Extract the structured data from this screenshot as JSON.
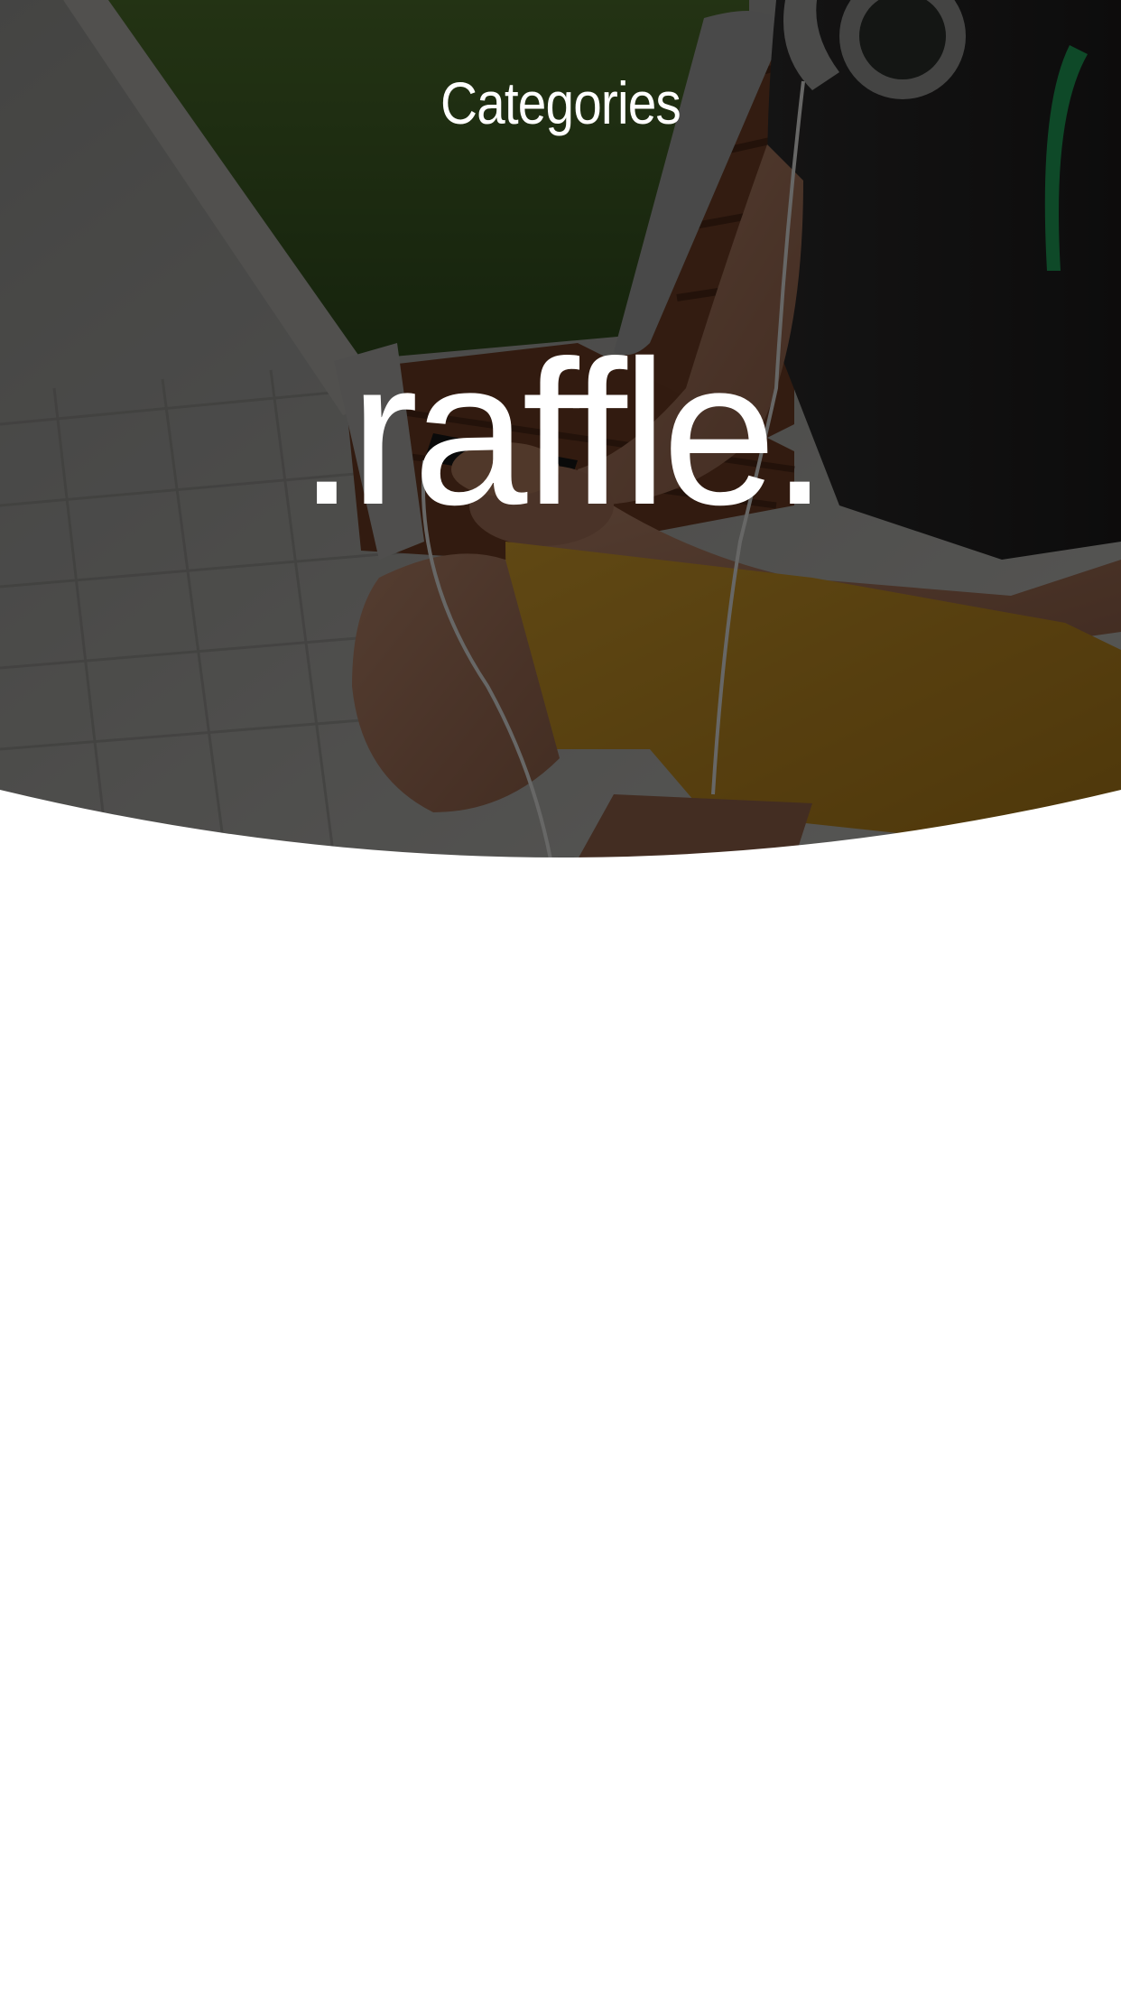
{
  "header": {
    "title": "Categories"
  },
  "hero": {
    "brand": ".raffle.",
    "background_image": "man-on-bench-with-headphones-and-phone-photo",
    "overlay_color": "#000000"
  },
  "colors": {
    "background": "#ffffff",
    "text_on_hero": "#ffffff",
    "shorts_accent": "#c8962a",
    "headphone_accent": "#1f9a55"
  }
}
